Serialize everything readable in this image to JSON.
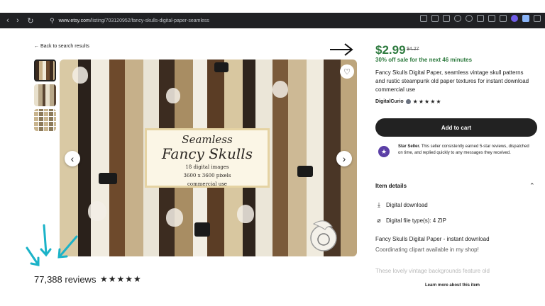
{
  "browser": {
    "url_domain": "www.etsy.com",
    "url_path": "/listing/703120952/fancy-skulls-digital-paper-seamless",
    "back_icon": "back-arrow-icon",
    "forward_icon": "forward-arrow-icon",
    "reload_icon": "reload-icon"
  },
  "nav": {
    "back_link": "Back to search results"
  },
  "gallery": {
    "image_title_line1": "Seamless",
    "image_title_line2": "Fancy Skulls",
    "image_subtitle_lines": [
      "18 digital images",
      "3600 x 3600 pixels",
      "commercial use"
    ],
    "prev_label": "‹",
    "next_label": "›",
    "favorite_icon": "♡"
  },
  "reviews": {
    "count_label": "77,388 reviews",
    "stars": "★★★★★"
  },
  "listing": {
    "price": "$2.99",
    "old_price": "$4.27",
    "sale_text": "30% off sale for the next 46 minutes",
    "title": "Fancy Skulls Digital Paper, seamless vintage skull patterns and rustic steampunk old paper textures for instant download commercial use",
    "shop_name": "DigitalCurio",
    "shop_stars": "★★★★★",
    "add_to_cart": "Add to cart",
    "star_seller_title": "Star Seller.",
    "star_seller_text": " This seller consistently earned 5-star reviews, dispatched on time, and replied quickly to any messages they received.",
    "item_details_heading": "Item details",
    "details": [
      {
        "icon": "⤓",
        "text": "Digital download"
      },
      {
        "icon": "⌀",
        "text": "Digital file type(s): 4 ZIP"
      }
    ],
    "description_title": "Fancy Skulls Digital Paper - instant download",
    "description_line2": "Coordinating clipart available in my shop!",
    "description_line3": "These lovely vintage backgrounds feature old",
    "learn_more": "Learn more about this item"
  },
  "colors": {
    "sale_green": "#2d7a3e",
    "annotation_cyan": "#1bb3c8",
    "button_dark": "#222222"
  }
}
